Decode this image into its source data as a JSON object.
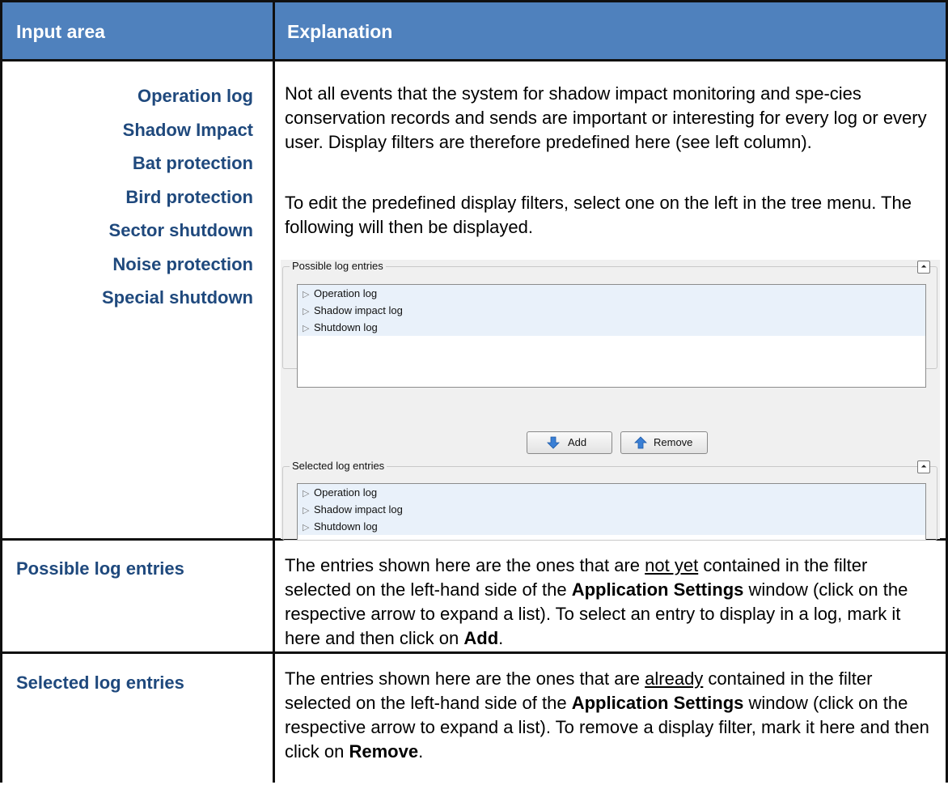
{
  "header": {
    "col_left": "Input area",
    "col_right": "Explanation"
  },
  "row1": {
    "filters": [
      "Operation log",
      "Shadow Impact",
      "Bat protection",
      "Bird protection",
      "Sector shutdown",
      "Noise protection",
      "Special shutdown"
    ],
    "para1": "Not all events that the system for shadow impact monitoring and spe-cies conservation records and sends are important or interesting for every log or every user. Display filters are therefore predefined here (see left column).",
    "para2": "To edit the predefined display filters, select one on the left in the tree menu. The following will then be displayed."
  },
  "dialog": {
    "possible_title": "Possible log entries",
    "possible_items": [
      "Operation log",
      "Shadow impact log",
      "Shutdown log"
    ],
    "add_label": "Add",
    "remove_label": "Remove",
    "selected_title": "Selected log entries",
    "selected_items": [
      "Operation log",
      "Shadow impact log",
      "Shutdown log"
    ],
    "collapse_glyph": "⏶"
  },
  "row2": {
    "term": "Possible log entries",
    "t1": "The entries shown here are the ones that are ",
    "u": "not yet",
    "t2": " contained in the filter selected on the left-hand side of the ",
    "b1": "Application Settings",
    "t3": " window (click on the respective arrow to expand a list). To select an entry to display in a log, mark it here and then click on ",
    "b2": "Add",
    "t4": "."
  },
  "row3": {
    "term": "Selected log entries",
    "t1": "The entries shown here are the ones that are ",
    "u": "already",
    "t2": " contained in the filter selected on the left-hand side of the ",
    "b1": "Application Settings",
    "t3": " window (click on the respective arrow to expand a list). To remove a display filter, mark it here and then click on ",
    "b2": "Remove",
    "t4": "."
  },
  "colors": {
    "header_bg": "#4f81bd",
    "term_blue": "#1f497d",
    "tree_row": "#e9f1fa"
  }
}
